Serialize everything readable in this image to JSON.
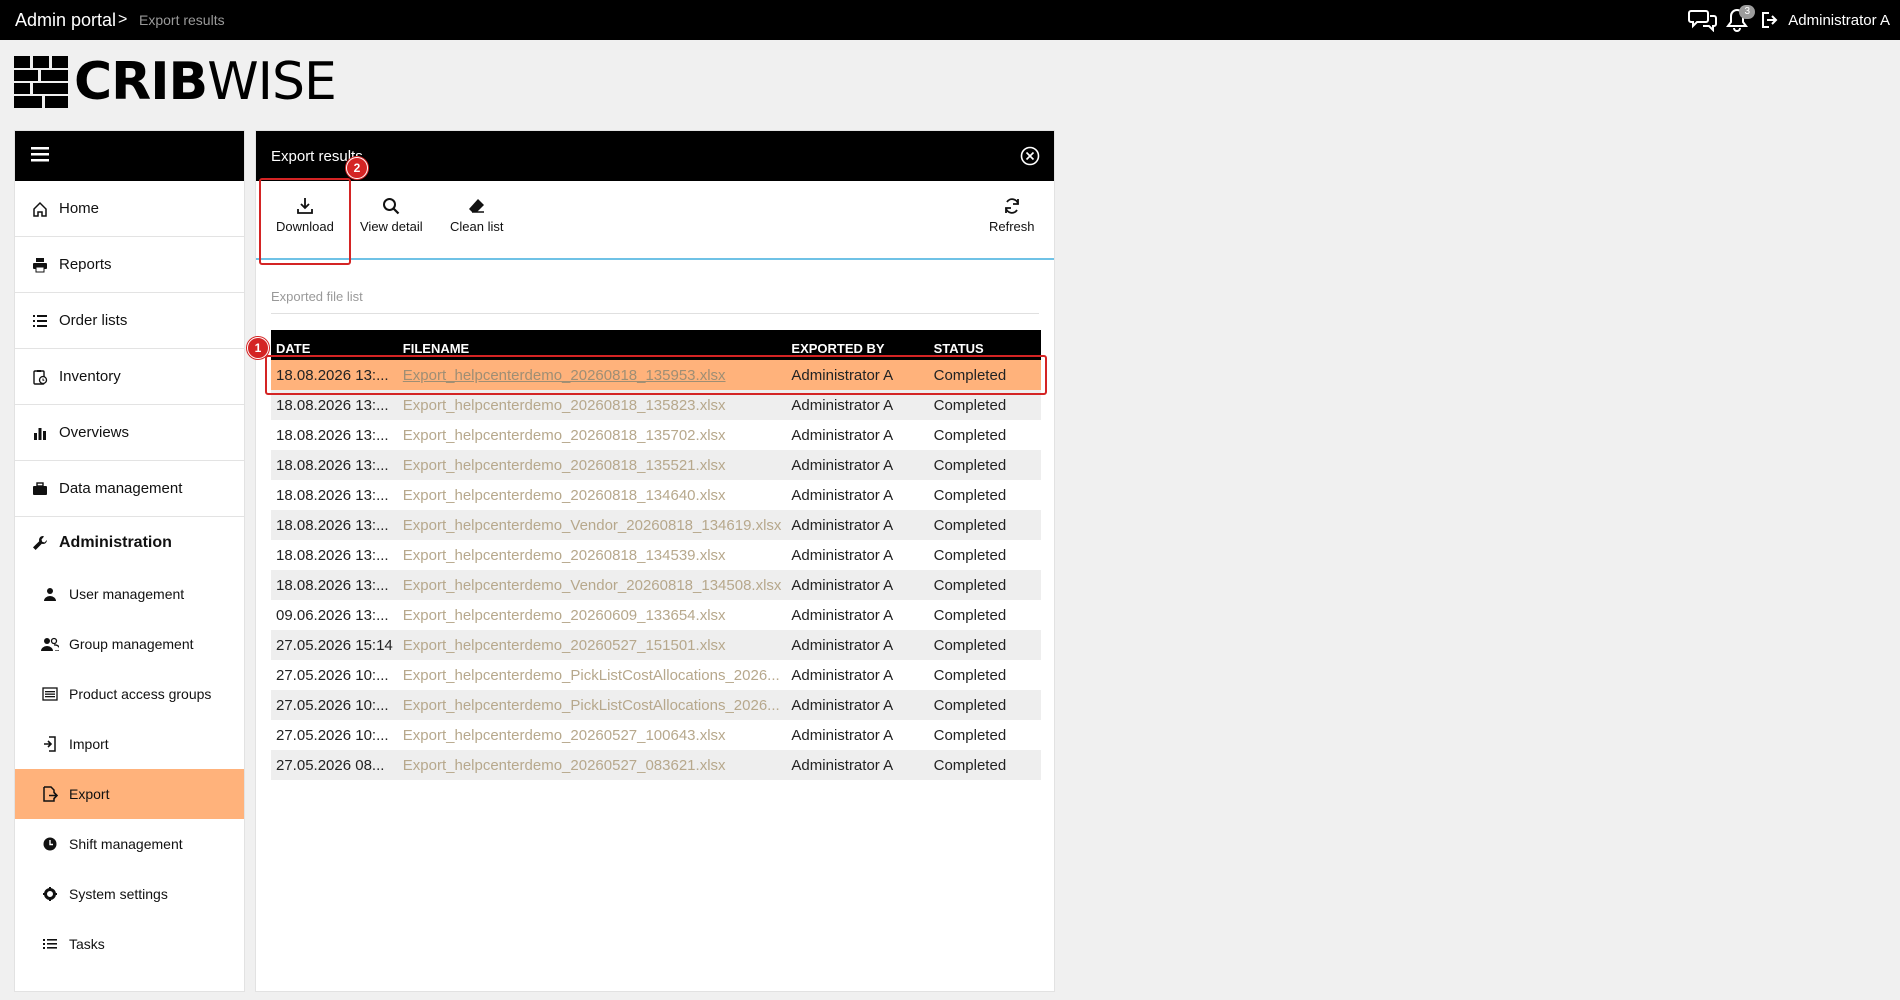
{
  "topbar": {
    "breadcrumb_root": "Admin portal",
    "breadcrumb_sep": ">",
    "breadcrumb_current": "Export results",
    "notification_count": "3",
    "user_name": "Administrator A"
  },
  "logo": {
    "text_bold": "CRIB",
    "text_light": "WISE"
  },
  "sidebar": {
    "items": [
      {
        "label": "Home",
        "icon": "home-icon"
      },
      {
        "label": "Reports",
        "icon": "printer-icon"
      },
      {
        "label": "Order lists",
        "icon": "list-icon"
      },
      {
        "label": "Inventory",
        "icon": "clipboard-clock-icon"
      },
      {
        "label": "Overviews",
        "icon": "bar-chart-icon"
      },
      {
        "label": "Data management",
        "icon": "briefcase-icon"
      }
    ],
    "admin_label": "Administration",
    "sub_items": [
      {
        "label": "User management",
        "icon": "user-icon"
      },
      {
        "label": "Group management",
        "icon": "users-icon"
      },
      {
        "label": "Product access groups",
        "icon": "list-box-icon"
      },
      {
        "label": "Import",
        "icon": "import-icon"
      },
      {
        "label": "Export",
        "icon": "export-icon"
      },
      {
        "label": "Shift management",
        "icon": "clock-icon"
      },
      {
        "label": "System settings",
        "icon": "gear-icon"
      },
      {
        "label": "Tasks",
        "icon": "tasks-icon"
      }
    ]
  },
  "panel": {
    "title": "Export results",
    "toolbar": {
      "download": "Download",
      "view_detail": "View detail",
      "clean_list": "Clean list",
      "refresh": "Refresh"
    },
    "section_label": "Exported file list",
    "columns": [
      "DATE",
      "FILENAME",
      "EXPORTED BY",
      "STATUS"
    ],
    "rows": [
      [
        "18.08.2026 13:...",
        "Export_helpcenterdemo_20260818_135953.xlsx",
        "Administrator A",
        "Completed"
      ],
      [
        "18.08.2026 13:...",
        "Export_helpcenterdemo_20260818_135823.xlsx",
        "Administrator A",
        "Completed"
      ],
      [
        "18.08.2026 13:...",
        "Export_helpcenterdemo_20260818_135702.xlsx",
        "Administrator A",
        "Completed"
      ],
      [
        "18.08.2026 13:...",
        "Export_helpcenterdemo_20260818_135521.xlsx",
        "Administrator A",
        "Completed"
      ],
      [
        "18.08.2026 13:...",
        "Export_helpcenterdemo_20260818_134640.xlsx",
        "Administrator A",
        "Completed"
      ],
      [
        "18.08.2026 13:...",
        "Export_helpcenterdemo_Vendor_20260818_134619.xlsx",
        "Administrator A",
        "Completed"
      ],
      [
        "18.08.2026 13:...",
        "Export_helpcenterdemo_20260818_134539.xlsx",
        "Administrator A",
        "Completed"
      ],
      [
        "18.08.2026 13:...",
        "Export_helpcenterdemo_Vendor_20260818_134508.xlsx",
        "Administrator A",
        "Completed"
      ],
      [
        "09.06.2026 13:...",
        "Export_helpcenterdemo_20260609_133654.xlsx",
        "Administrator A",
        "Completed"
      ],
      [
        "27.05.2026 15:14",
        "Export_helpcenterdemo_20260527_151501.xlsx",
        "Administrator A",
        "Completed"
      ],
      [
        "27.05.2026 10:...",
        "Export_helpcenterdemo_PickListCostAllocations_2026...",
        "Administrator A",
        "Completed"
      ],
      [
        "27.05.2026 10:...",
        "Export_helpcenterdemo_PickListCostAllocations_2026...",
        "Administrator A",
        "Completed"
      ],
      [
        "27.05.2026 10:...",
        "Export_helpcenterdemo_20260527_100643.xlsx",
        "Administrator A",
        "Completed"
      ],
      [
        "27.05.2026 08...",
        "Export_helpcenterdemo_20260527_083621.xlsx",
        "Administrator A",
        "Completed"
      ]
    ]
  },
  "callouts": {
    "one": "1",
    "two": "2"
  },
  "colors": {
    "accent": "#ffb27b",
    "callout": "#d42424",
    "toolbar_rule": "#6fc2e6"
  }
}
